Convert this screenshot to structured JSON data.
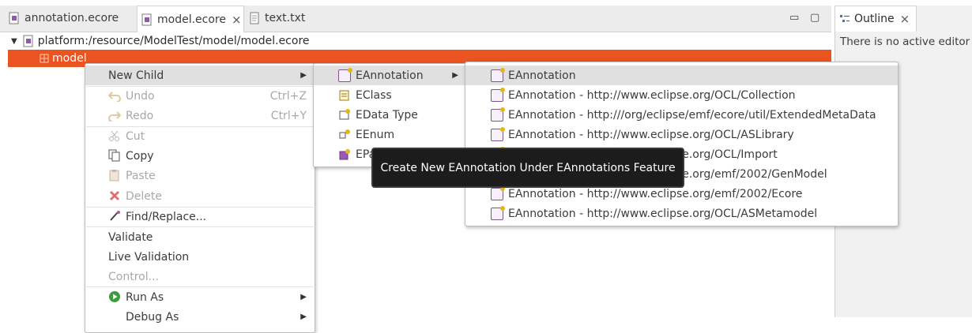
{
  "tabs": [
    {
      "label": "annotation.ecore",
      "icon": "ecore-file-icon"
    },
    {
      "label": "model.ecore",
      "icon": "ecore-file-icon",
      "active": true,
      "close": "×"
    },
    {
      "label": "text.txt",
      "icon": "text-file-icon"
    }
  ],
  "window_controls": {
    "minimize": "▭",
    "maximize": "▢"
  },
  "tree": {
    "root": "platform:/resource/ModelTest/model/model.ecore",
    "selected": "model"
  },
  "outline": {
    "tab_label": "Outline",
    "close": "×",
    "message": "There is no active editor t"
  },
  "context_menu": [
    {
      "label": "New Child",
      "submenu": true,
      "highlight": true
    },
    {
      "label": "Undo",
      "accel": "Ctrl+Z",
      "disabled": true,
      "icon": "undo-icon"
    },
    {
      "label": "Redo",
      "accel": "Ctrl+Y",
      "disabled": true,
      "icon": "redo-icon"
    },
    {
      "label": "Cut",
      "disabled": true,
      "icon": "cut-icon"
    },
    {
      "label": "Copy",
      "icon": "copy-icon"
    },
    {
      "label": "Paste",
      "disabled": true,
      "icon": "paste-icon"
    },
    {
      "label": "Delete",
      "disabled": true,
      "icon": "delete-icon"
    },
    {
      "label": "Find/Replace...",
      "icon": "find-replace-icon"
    },
    {
      "label": "Validate"
    },
    {
      "label": "Live Validation"
    },
    {
      "label": "Control...",
      "disabled": true
    },
    {
      "label": "Run As",
      "submenu": true,
      "icon": "run-icon"
    },
    {
      "label": "Debug As",
      "submenu": true
    }
  ],
  "child_menu": [
    {
      "label": "EAnnotation",
      "submenu": true,
      "highlight": true,
      "icon": "eannotation-icon"
    },
    {
      "label": "EClass",
      "icon": "eclass-icon"
    },
    {
      "label": "EData Type",
      "icon": "edatatype-icon"
    },
    {
      "label": "EEnum",
      "icon": "eenum-icon"
    },
    {
      "label": "EPa",
      "icon": "epackage-icon"
    }
  ],
  "annotation_menu": [
    {
      "label": "EAnnotation",
      "highlight": true
    },
    {
      "label": "EAnnotation - http://www.eclipse.org/OCL/Collection"
    },
    {
      "label": "EAnnotation - http:///org/eclipse/emf/ecore/util/ExtendedMetaData"
    },
    {
      "label": "EAnnotation - http://www.eclipse.org/OCL/ASLibrary"
    },
    {
      "label": "EAnnotation - http://www.eclipse.org/OCL/Import"
    },
    {
      "label": "EAnnotation - http://www.eclipse.org/emf/2002/GenModel"
    },
    {
      "label": "EAnnotation - http://www.eclipse.org/emf/2002/Ecore"
    },
    {
      "label": "EAnnotation - http://www.eclipse.org/OCL/ASMetamodel"
    }
  ],
  "annotation_menu_visible_prefix": [
    "EAnnotation",
    "EAnnotation - http://www.eclipse.org/OCL/Collection",
    "EAnnotation - http:///org/eclipse/emf/ecore/util/ExtendedMetaData",
    "EAnnotation - http://www.eclipse.org/OCL/ASLibrary"
  ],
  "annotation_menu_partial": [
    "org/OCL/Import",
    "org/emf/2002/GenModel"
  ],
  "tooltip": "Create New EAnnotation Under EAnnotations Feature",
  "colors": {
    "selection": "#e95420",
    "menu_highlight": "#e0e0e0",
    "tooltip_bg": "#1c1c1c"
  }
}
